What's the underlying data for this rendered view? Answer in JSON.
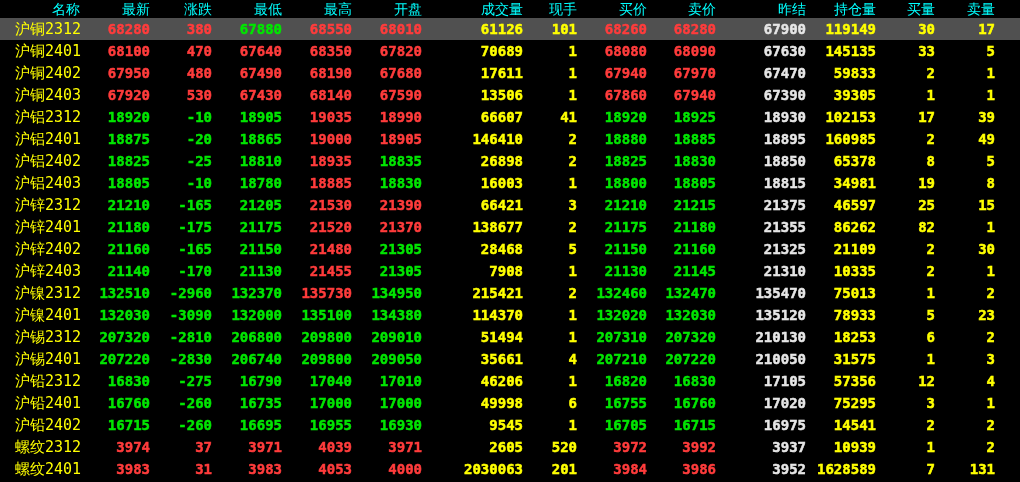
{
  "columns": [
    "名称",
    "最新",
    "涨跌",
    "最低",
    "最高",
    "开盘",
    "成交量",
    "现手",
    "买价",
    "卖价",
    "昨结",
    "持仓量",
    "买量",
    "卖量"
  ],
  "rows": [
    {
      "name": "沪铜2312",
      "selected": true,
      "cells": [
        {
          "text": "68280",
          "color": "#ff3c3c"
        },
        {
          "text": "380",
          "color": "#ff3c3c"
        },
        {
          "text": "67880",
          "color": "#00e600"
        },
        {
          "text": "68550",
          "color": "#ff3c3c"
        },
        {
          "text": "68010",
          "color": "#ff3c3c"
        },
        "61126",
        "101",
        {
          "text": "68260",
          "color": "#ff3c3c"
        },
        {
          "text": "68280",
          "color": "#ff3c3c"
        },
        "67900",
        "119149",
        "30",
        "17"
      ]
    },
    {
      "name": "沪铜2401",
      "selected": false,
      "cells": [
        {
          "text": "68100",
          "color": "#ff3c3c"
        },
        {
          "text": "470",
          "color": "#ff3c3c"
        },
        {
          "text": "67640",
          "color": "#ff3c3c"
        },
        {
          "text": "68350",
          "color": "#ff3c3c"
        },
        {
          "text": "67820",
          "color": "#ff3c3c"
        },
        "70689",
        "1",
        {
          "text": "68080",
          "color": "#ff3c3c"
        },
        {
          "text": "68090",
          "color": "#ff3c3c"
        },
        "67630",
        "145135",
        "33",
        "5"
      ]
    },
    {
      "name": "沪铜2402",
      "selected": false,
      "cells": [
        {
          "text": "67950",
          "color": "#ff3c3c"
        },
        {
          "text": "480",
          "color": "#ff3c3c"
        },
        {
          "text": "67490",
          "color": "#ff3c3c"
        },
        {
          "text": "68190",
          "color": "#ff3c3c"
        },
        {
          "text": "67680",
          "color": "#ff3c3c"
        },
        "17611",
        "1",
        {
          "text": "67940",
          "color": "#ff3c3c"
        },
        {
          "text": "67970",
          "color": "#ff3c3c"
        },
        "67470",
        "59833",
        "2",
        "1"
      ]
    },
    {
      "name": "沪铜2403",
      "selected": false,
      "cells": [
        {
          "text": "67920",
          "color": "#ff3c3c"
        },
        {
          "text": "530",
          "color": "#ff3c3c"
        },
        {
          "text": "67430",
          "color": "#ff3c3c"
        },
        {
          "text": "68140",
          "color": "#ff3c3c"
        },
        {
          "text": "67590",
          "color": "#ff3c3c"
        },
        "13506",
        "1",
        {
          "text": "67860",
          "color": "#ff3c3c"
        },
        {
          "text": "67940",
          "color": "#ff3c3c"
        },
        "67390",
        "39305",
        "1",
        "1"
      ]
    },
    {
      "name": "沪铝2312",
      "selected": false,
      "cells": [
        {
          "text": "18920",
          "color": "#00e600"
        },
        {
          "text": "-10",
          "color": "#00e600"
        },
        {
          "text": "18905",
          "color": "#00e600"
        },
        {
          "text": "19035",
          "color": "#ff3c3c"
        },
        {
          "text": "18990",
          "color": "#ff3c3c"
        },
        "66607",
        "41",
        {
          "text": "18920",
          "color": "#00e600"
        },
        {
          "text": "18925",
          "color": "#00e600"
        },
        "18930",
        "102153",
        "17",
        "39"
      ]
    },
    {
      "name": "沪铝2401",
      "selected": false,
      "cells": [
        {
          "text": "18875",
          "color": "#00e600"
        },
        {
          "text": "-20",
          "color": "#00e600"
        },
        {
          "text": "18865",
          "color": "#00e600"
        },
        {
          "text": "19000",
          "color": "#ff3c3c"
        },
        {
          "text": "18905",
          "color": "#ff3c3c"
        },
        "146410",
        "2",
        {
          "text": "18880",
          "color": "#00e600"
        },
        {
          "text": "18885",
          "color": "#00e600"
        },
        "18895",
        "160985",
        "2",
        "49"
      ]
    },
    {
      "name": "沪铝2402",
      "selected": false,
      "cells": [
        {
          "text": "18825",
          "color": "#00e600"
        },
        {
          "text": "-25",
          "color": "#00e600"
        },
        {
          "text": "18810",
          "color": "#00e600"
        },
        {
          "text": "18935",
          "color": "#ff3c3c"
        },
        {
          "text": "18835",
          "color": "#00e600"
        },
        "26898",
        "2",
        {
          "text": "18825",
          "color": "#00e600"
        },
        {
          "text": "18830",
          "color": "#00e600"
        },
        "18850",
        "65378",
        "8",
        "5"
      ]
    },
    {
      "name": "沪铝2403",
      "selected": false,
      "cells": [
        {
          "text": "18805",
          "color": "#00e600"
        },
        {
          "text": "-10",
          "color": "#00e600"
        },
        {
          "text": "18780",
          "color": "#00e600"
        },
        {
          "text": "18885",
          "color": "#ff3c3c"
        },
        {
          "text": "18830",
          "color": "#00e600"
        },
        "16003",
        "1",
        {
          "text": "18800",
          "color": "#00e600"
        },
        {
          "text": "18805",
          "color": "#00e600"
        },
        "18815",
        "34981",
        "19",
        "8"
      ]
    },
    {
      "name": "沪锌2312",
      "selected": false,
      "cells": [
        {
          "text": "21210",
          "color": "#00e600"
        },
        {
          "text": "-165",
          "color": "#00e600"
        },
        {
          "text": "21205",
          "color": "#00e600"
        },
        {
          "text": "21530",
          "color": "#ff3c3c"
        },
        {
          "text": "21390",
          "color": "#ff3c3c"
        },
        "66421",
        "3",
        {
          "text": "21210",
          "color": "#00e600"
        },
        {
          "text": "21215",
          "color": "#00e600"
        },
        "21375",
        "46597",
        "25",
        "15"
      ]
    },
    {
      "name": "沪锌2401",
      "selected": false,
      "cells": [
        {
          "text": "21180",
          "color": "#00e600"
        },
        {
          "text": "-175",
          "color": "#00e600"
        },
        {
          "text": "21175",
          "color": "#00e600"
        },
        {
          "text": "21520",
          "color": "#ff3c3c"
        },
        {
          "text": "21370",
          "color": "#ff3c3c"
        },
        "138677",
        "2",
        {
          "text": "21175",
          "color": "#00e600"
        },
        {
          "text": "21180",
          "color": "#00e600"
        },
        "21355",
        "86262",
        "82",
        "1"
      ]
    },
    {
      "name": "沪锌2402",
      "selected": false,
      "cells": [
        {
          "text": "21160",
          "color": "#00e600"
        },
        {
          "text": "-165",
          "color": "#00e600"
        },
        {
          "text": "21150",
          "color": "#00e600"
        },
        {
          "text": "21480",
          "color": "#ff3c3c"
        },
        {
          "text": "21305",
          "color": "#00e600"
        },
        "28468",
        "5",
        {
          "text": "21150",
          "color": "#00e600"
        },
        {
          "text": "21160",
          "color": "#00e600"
        },
        "21325",
        "21109",
        "2",
        "30"
      ]
    },
    {
      "name": "沪锌2403",
      "selected": false,
      "cells": [
        {
          "text": "21140",
          "color": "#00e600"
        },
        {
          "text": "-170",
          "color": "#00e600"
        },
        {
          "text": "21130",
          "color": "#00e600"
        },
        {
          "text": "21455",
          "color": "#ff3c3c"
        },
        {
          "text": "21305",
          "color": "#00e600"
        },
        "7908",
        "1",
        {
          "text": "21130",
          "color": "#00e600"
        },
        {
          "text": "21145",
          "color": "#00e600"
        },
        "21310",
        "10335",
        "2",
        "1"
      ]
    },
    {
      "name": "沪镍2312",
      "selected": false,
      "cells": [
        {
          "text": "132510",
          "color": "#00e600"
        },
        {
          "text": "-2960",
          "color": "#00e600"
        },
        {
          "text": "132370",
          "color": "#00e600"
        },
        {
          "text": "135730",
          "color": "#ff3c3c"
        },
        {
          "text": "134950",
          "color": "#00e600"
        },
        "215421",
        "2",
        {
          "text": "132460",
          "color": "#00e600"
        },
        {
          "text": "132470",
          "color": "#00e600"
        },
        "135470",
        "75013",
        "1",
        "2"
      ]
    },
    {
      "name": "沪镍2401",
      "selected": false,
      "cells": [
        {
          "text": "132030",
          "color": "#00e600"
        },
        {
          "text": "-3090",
          "color": "#00e600"
        },
        {
          "text": "132000",
          "color": "#00e600"
        },
        {
          "text": "135100",
          "color": "#00e600"
        },
        {
          "text": "134380",
          "color": "#00e600"
        },
        "114370",
        "1",
        {
          "text": "132020",
          "color": "#00e600"
        },
        {
          "text": "132030",
          "color": "#00e600"
        },
        "135120",
        "78933",
        "5",
        "23"
      ]
    },
    {
      "name": "沪锡2312",
      "selected": false,
      "cells": [
        {
          "text": "207320",
          "color": "#00e600"
        },
        {
          "text": "-2810",
          "color": "#00e600"
        },
        {
          "text": "206800",
          "color": "#00e600"
        },
        {
          "text": "209800",
          "color": "#00e600"
        },
        {
          "text": "209010",
          "color": "#00e600"
        },
        "51494",
        "1",
        {
          "text": "207310",
          "color": "#00e600"
        },
        {
          "text": "207320",
          "color": "#00e600"
        },
        "210130",
        "18253",
        "6",
        "2"
      ]
    },
    {
      "name": "沪锡2401",
      "selected": false,
      "cells": [
        {
          "text": "207220",
          "color": "#00e600"
        },
        {
          "text": "-2830",
          "color": "#00e600"
        },
        {
          "text": "206740",
          "color": "#00e600"
        },
        {
          "text": "209800",
          "color": "#00e600"
        },
        {
          "text": "209050",
          "color": "#00e600"
        },
        "35661",
        "4",
        {
          "text": "207210",
          "color": "#00e600"
        },
        {
          "text": "207220",
          "color": "#00e600"
        },
        "210050",
        "31575",
        "1",
        "3"
      ]
    },
    {
      "name": "沪铅2312",
      "selected": false,
      "cells": [
        {
          "text": "16830",
          "color": "#00e600"
        },
        {
          "text": "-275",
          "color": "#00e600"
        },
        {
          "text": "16790",
          "color": "#00e600"
        },
        {
          "text": "17040",
          "color": "#00e600"
        },
        {
          "text": "17010",
          "color": "#00e600"
        },
        "46206",
        "1",
        {
          "text": "16820",
          "color": "#00e600"
        },
        {
          "text": "16830",
          "color": "#00e600"
        },
        "17105",
        "57356",
        "12",
        "4"
      ]
    },
    {
      "name": "沪铅2401",
      "selected": false,
      "cells": [
        {
          "text": "16760",
          "color": "#00e600"
        },
        {
          "text": "-260",
          "color": "#00e600"
        },
        {
          "text": "16735",
          "color": "#00e600"
        },
        {
          "text": "17000",
          "color": "#00e600"
        },
        {
          "text": "17000",
          "color": "#00e600"
        },
        "49998",
        "6",
        {
          "text": "16755",
          "color": "#00e600"
        },
        {
          "text": "16760",
          "color": "#00e600"
        },
        "17020",
        "75295",
        "3",
        "1"
      ]
    },
    {
      "name": "沪铅2402",
      "selected": false,
      "cells": [
        {
          "text": "16715",
          "color": "#00e600"
        },
        {
          "text": "-260",
          "color": "#00e600"
        },
        {
          "text": "16695",
          "color": "#00e600"
        },
        {
          "text": "16955",
          "color": "#00e600"
        },
        {
          "text": "16930",
          "color": "#00e600"
        },
        "9545",
        "1",
        {
          "text": "16705",
          "color": "#00e600"
        },
        {
          "text": "16715",
          "color": "#00e600"
        },
        "16975",
        "14541",
        "2",
        "2"
      ]
    },
    {
      "name": "螺纹2312",
      "selected": false,
      "cells": [
        {
          "text": "3974",
          "color": "#ff3c3c"
        },
        {
          "text": "37",
          "color": "#ff3c3c"
        },
        {
          "text": "3971",
          "color": "#ff3c3c"
        },
        {
          "text": "4039",
          "color": "#ff3c3c"
        },
        {
          "text": "3971",
          "color": "#ff3c3c"
        },
        "2605",
        "520",
        {
          "text": "3972",
          "color": "#ff3c3c"
        },
        {
          "text": "3992",
          "color": "#ff3c3c"
        },
        "3937",
        "10939",
        "1",
        "2"
      ]
    },
    {
      "name": "螺纹2401",
      "selected": false,
      "cells": [
        {
          "text": "3983",
          "color": "#ff3c3c"
        },
        {
          "text": "31",
          "color": "#ff3c3c"
        },
        {
          "text": "3983",
          "color": "#ff3c3c"
        },
        {
          "text": "4053",
          "color": "#ff3c3c"
        },
        {
          "text": "4000",
          "color": "#ff3c3c"
        },
        "2030063",
        "201",
        {
          "text": "3984",
          "color": "#ff3c3c"
        },
        {
          "text": "3986",
          "color": "#ff3c3c"
        },
        "3952",
        "1628589",
        "7",
        "131"
      ]
    }
  ]
}
